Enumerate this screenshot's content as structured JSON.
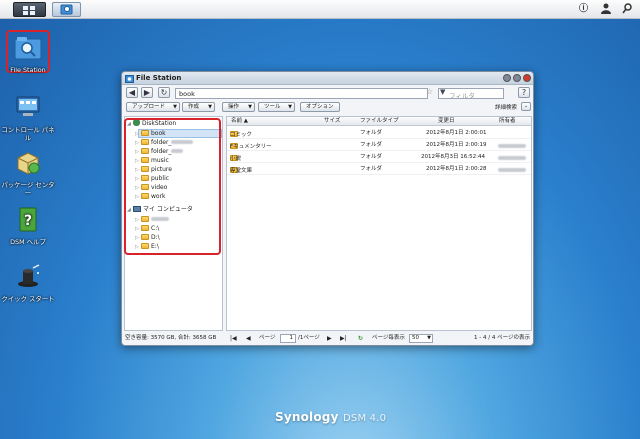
{
  "taskbar": {
    "icons": [
      "main-menu-icon",
      "file-station-icon",
      "info-icon",
      "user-icon",
      "search-icon"
    ]
  },
  "desktop": {
    "icons": [
      {
        "label": "File Station",
        "icon": "file-station-icon"
      },
      {
        "label": "コントロール パネル",
        "icon": "control-panel-icon"
      },
      {
        "label": "パッケージ センター",
        "icon": "package-center-icon"
      },
      {
        "label": "DSM ヘルプ",
        "icon": "help-icon"
      },
      {
        "label": "クイック スタート",
        "icon": "quick-start-icon"
      }
    ]
  },
  "window": {
    "title": "File Station",
    "path": "book",
    "filter_placeholder": "フィルタ",
    "help": "?",
    "toolbar": {
      "upload": "アップロード",
      "create": "作成",
      "action": "操作",
      "tools": "ツール",
      "options": "オプション",
      "advanced": "詳細検索"
    },
    "tree": {
      "root1": "DiskStation",
      "items1": [
        "book",
        "folder_",
        "folder_",
        "music",
        "picture",
        "public",
        "video",
        "work"
      ],
      "root2": "マイ コンピュータ",
      "items2": [
        "",
        "C:\\",
        "D:\\",
        "E:\\"
      ]
    },
    "columns": {
      "name": "名前 ▲",
      "size": "サイズ",
      "type": "ファイルタイプ",
      "modified": "変更日",
      "owner": "所有者"
    },
    "rows": [
      {
        "name": "コミック",
        "type": "フォルダ",
        "modified": "2012年8月1日 2:00:01"
      },
      {
        "name": "Fキュメンタリー",
        "type": "フォルダ",
        "modified": "2012年8月1日 2:00:19"
      },
      {
        "name": "小説",
        "type": "フォルダ",
        "modified": "2012年8月3日 16:52:44"
      },
      {
        "name": "専堂文庫",
        "type": "フォルダ",
        "modified": "2012年8月1日 2:00:28"
      }
    ],
    "status_left": "空き容量: 3570 GB, 合計: 3658 GB",
    "pager": {
      "page_label": "ページ",
      "page_value": "1",
      "of": "/1ページ",
      "per_page_label": "ページ毎表示",
      "per_page": "50",
      "summary": "1 - 4 / 4 ページの表示"
    }
  },
  "brand": {
    "name": "Synology",
    "product": "DSM 4.0"
  },
  "colors": {
    "accent_red": "#d8232a",
    "folder": "#f0b534"
  }
}
